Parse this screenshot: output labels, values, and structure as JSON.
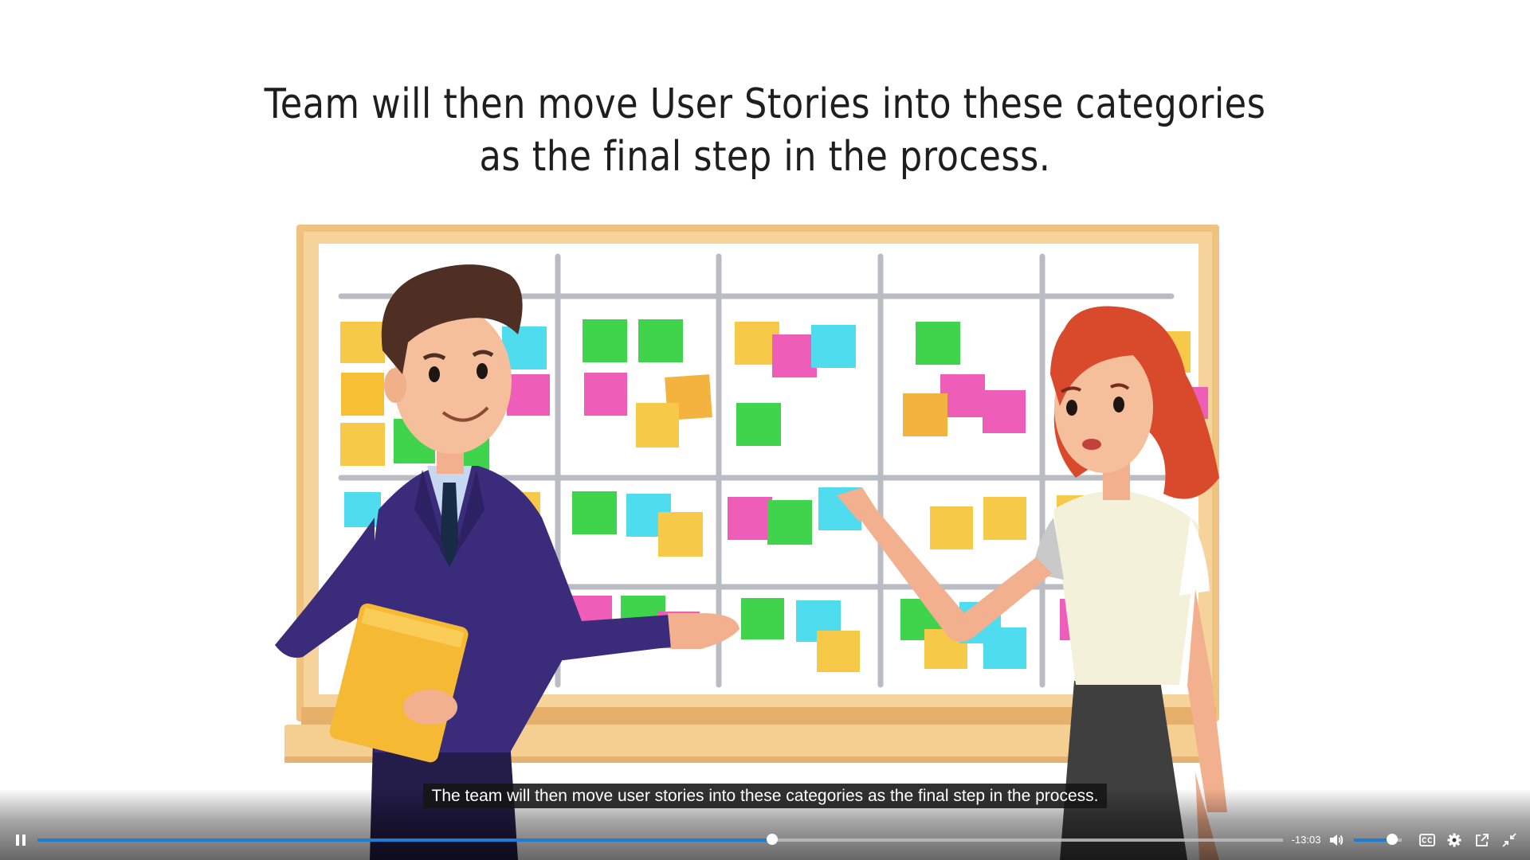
{
  "slide": {
    "title_line1": "Team will then move User Stories into these categories",
    "title_line2": "as the final step in the process."
  },
  "caption": {
    "text": "The team will then move user stories into these categories as the final step in the process."
  },
  "player": {
    "state": "playing",
    "progress_fraction": 0.59,
    "time_remaining": "-13:03",
    "volume_fraction": 0.8,
    "captions_enabled": true,
    "icons": {
      "play_pause": "pause-icon",
      "volume": "volume-icon",
      "captions": "closed-captions-icon",
      "settings": "settings-gear-icon",
      "popout": "popout-icon",
      "exit_fullscreen": "exit-fullscreen-icon"
    },
    "accent_color": "#1c7cd6"
  },
  "illustration": {
    "description_icons": [
      "man-presenter",
      "woman-presenter",
      "scrum-board",
      "sticky-notes"
    ],
    "note_colors": [
      "#f7c948",
      "#3fd44c",
      "#ee5db7",
      "#3fdcef",
      "#f4b23e"
    ]
  }
}
